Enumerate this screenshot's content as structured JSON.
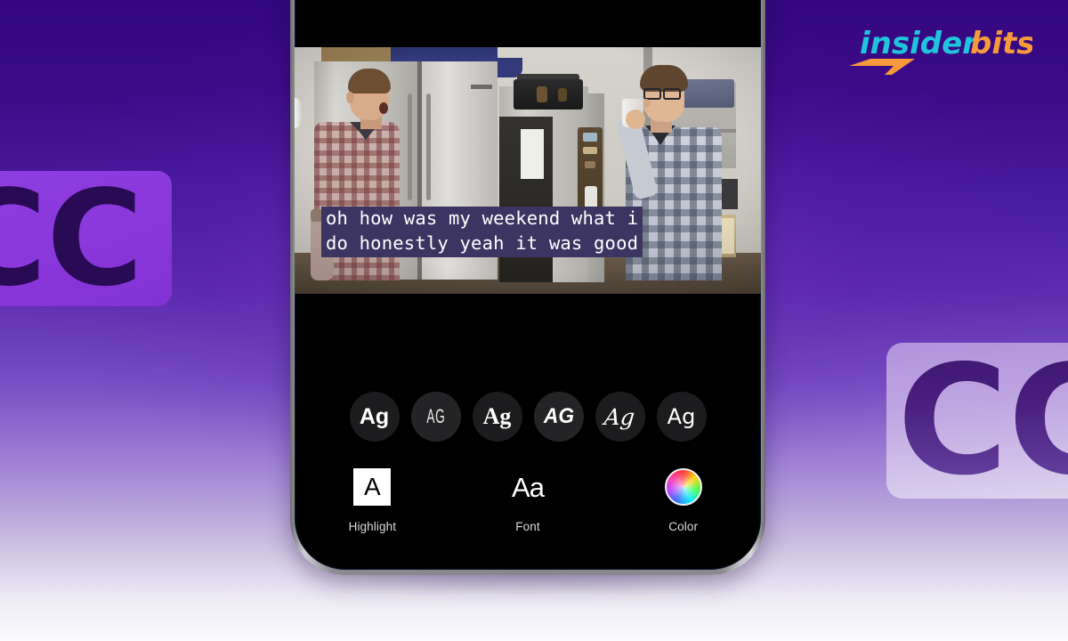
{
  "brand": {
    "name_part1": "insider",
    "name_part2": "bits",
    "color_cyan": "#21c4dd",
    "color_orange": "#f79a3c"
  },
  "decor": {
    "left_plate_text": "CC",
    "right_plate_text": "CC",
    "left_plate_bg": "#8a37dc",
    "left_plate_text_color": "#290a55",
    "right_plate_bg": "#c4ade4",
    "right_plate_text_color": "#4a1f80"
  },
  "background": {
    "top_color": "#35077f",
    "mid_color": "#7a4ec4",
    "bottom_color": "#fbfbfd"
  },
  "phone": {
    "frame_color": "#a9a9b0",
    "screen_color": "#000000"
  },
  "video": {
    "description": "Two men talking in an office break room by stainless steel refrigerators and a coffee machine"
  },
  "caption": {
    "line1": "oh how was my weekend what i",
    "line2": "do honestly yeah it was good",
    "highlight_color": "#3c3561",
    "text_color": "#ffffff"
  },
  "font_styles": [
    {
      "label": "Ag",
      "name": "sans-bold",
      "selected": true
    },
    {
      "label": "AG",
      "name": "condensed-thin",
      "selected": false
    },
    {
      "label": "Ag",
      "name": "serif",
      "selected": false
    },
    {
      "label": "AG",
      "name": "bold-italic",
      "selected": false
    },
    {
      "label": "Ag",
      "name": "script",
      "selected": false
    },
    {
      "label": "Ag",
      "name": "sans-regular",
      "selected": false
    }
  ],
  "tools": [
    {
      "label": "Highlight",
      "icon": "highlight-a-icon",
      "glyph": "A"
    },
    {
      "label": "Font",
      "icon": "font-aa-icon",
      "glyph": "Aa"
    },
    {
      "label": "Color",
      "icon": "color-wheel-icon",
      "glyph": ""
    }
  ]
}
